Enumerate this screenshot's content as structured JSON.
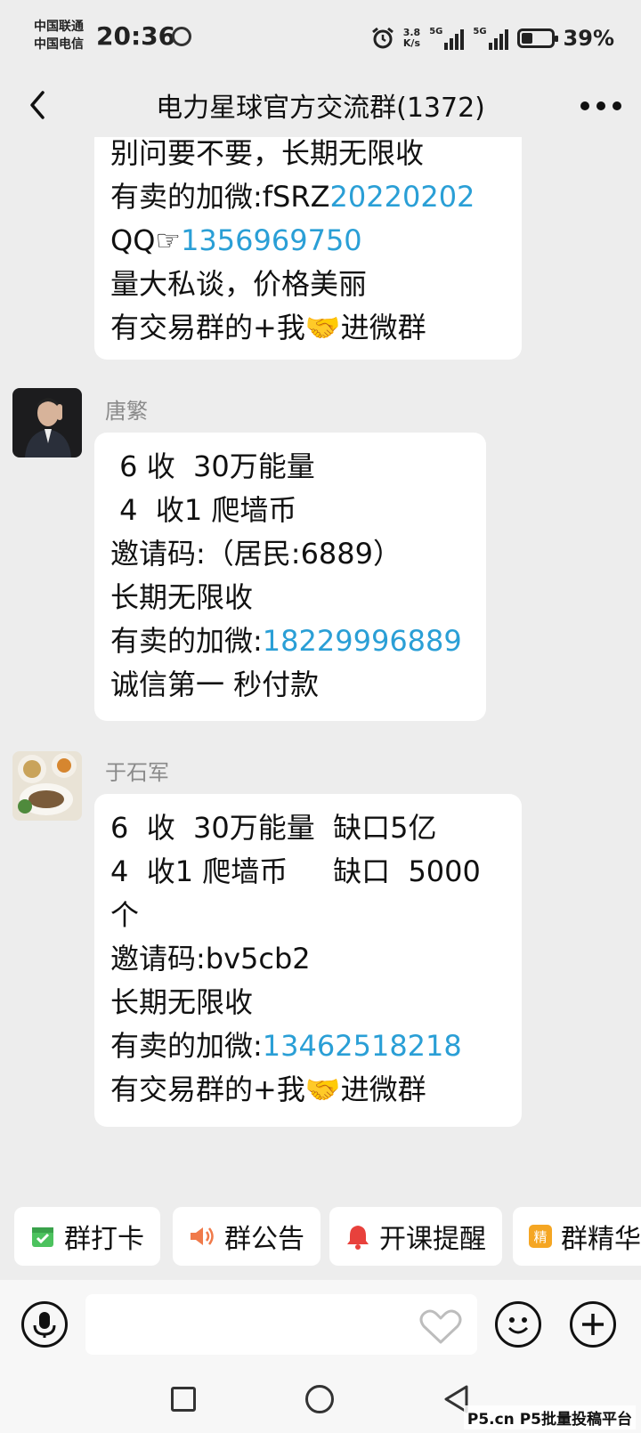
{
  "status_bar": {
    "carrier_1": "中国联通",
    "carrier_2": "中国电信",
    "time": "20:36",
    "speed_value": "3.8",
    "speed_unit": "K/s",
    "net_1": "5G",
    "net_2": "5G",
    "battery_percent_text": "39%",
    "battery_level": 0.39
  },
  "header": {
    "title": "电力星球官方交流群(1372)"
  },
  "messages": [
    {
      "sender": "",
      "lines": [
        {
          "segments": [
            {
              "text": "别问要不要，长期无限收",
              "link": false
            }
          ]
        },
        {
          "segments": [
            {
              "text": "有卖的加微:fSRZ",
              "link": false
            },
            {
              "text": "20220202",
              "link": true
            }
          ]
        },
        {
          "segments": [
            {
              "text": "QQ☞",
              "link": false
            },
            {
              "text": "1356969750",
              "link": true
            }
          ]
        },
        {
          "segments": [
            {
              "text": "量大私谈，价格美丽",
              "link": false
            }
          ]
        },
        {
          "segments": [
            {
              "text": "有交易群的+我🤝进微群",
              "link": false
            }
          ]
        }
      ]
    },
    {
      "sender": "唐繁",
      "lines": [
        {
          "segments": [
            {
              "text": " 6 收  30万能量",
              "link": false
            }
          ]
        },
        {
          "segments": [
            {
              "text": " 4  收1 爬墙币",
              "link": false
            }
          ]
        },
        {
          "segments": [
            {
              "text": "邀请码:（居民:6889）",
              "link": false
            }
          ]
        },
        {
          "segments": [
            {
              "text": "长期无限收",
              "link": false
            }
          ]
        },
        {
          "segments": [
            {
              "text": "有卖的加微:",
              "link": false
            },
            {
              "text": "18229996889",
              "link": true
            }
          ]
        },
        {
          "segments": [
            {
              "text": "诚信第一 秒付款",
              "link": false
            }
          ]
        }
      ]
    },
    {
      "sender": "于石军",
      "lines": [
        {
          "segments": [
            {
              "text": "6  收  30万能量  缺口5亿",
              "link": false
            }
          ]
        },
        {
          "segments": [
            {
              "text": "4  收1 爬墙币     缺口  5000",
              "link": false
            }
          ]
        },
        {
          "segments": [
            {
              "text": "个",
              "link": false
            }
          ]
        },
        {
          "segments": [
            {
              "text": "邀请码:bv5cb2",
              "link": false
            }
          ]
        },
        {
          "segments": [
            {
              "text": "长期无限收",
              "link": false
            }
          ]
        },
        {
          "segments": [
            {
              "text": "有卖的加微:",
              "link": false
            },
            {
              "text": "13462518218",
              "link": true
            }
          ]
        },
        {
          "segments": [
            {
              "text": "有交易群的+我🤝进微群",
              "link": false
            }
          ]
        }
      ]
    }
  ],
  "chips": [
    {
      "label": "群打卡",
      "icon": "calendar-check-icon",
      "color": "#4cc25e"
    },
    {
      "label": "群公告",
      "icon": "speaker-icon",
      "color": "#f07a4a"
    },
    {
      "label": "开课提醒",
      "icon": "bell-icon",
      "color": "#e8413c"
    },
    {
      "label": "群精华",
      "icon": "essence-icon",
      "color": "#f5a623",
      "icon_text": "精"
    }
  ],
  "input": {
    "placeholder": ""
  },
  "watermark": "P5.cn P5批量投稿平台",
  "colors": {
    "link": "#2a9fd6",
    "background": "#ededed",
    "bubble": "#ffffff"
  }
}
